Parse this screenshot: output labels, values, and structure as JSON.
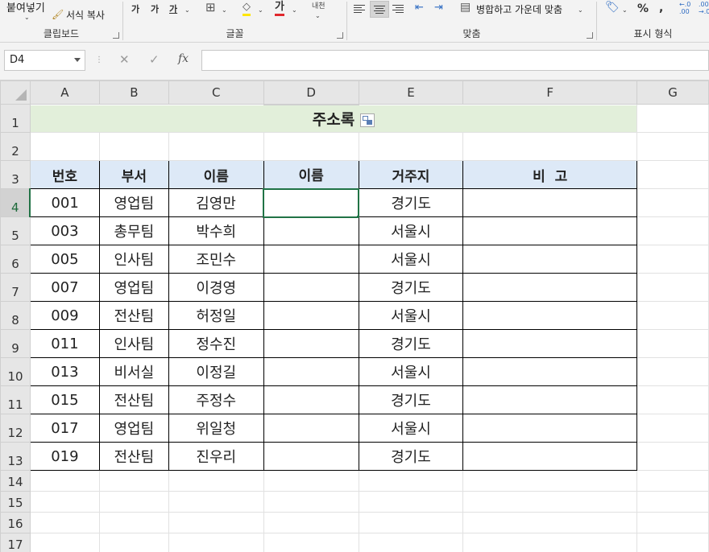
{
  "ribbon": {
    "clipboard": {
      "paste_label": "붙여넣기",
      "format_copy_label": "서식 복사",
      "group_label": "클립보드"
    },
    "font": {
      "group_label": "글꼴",
      "increase_font": "가",
      "decrease_font": "가",
      "strike_font": "가",
      "font_color_glyph": "가",
      "phonetic_glyph": "내천"
    },
    "alignment": {
      "merge_center_label": "병합하고 가운데 맞춤",
      "group_label": "맞춤"
    },
    "number": {
      "group_label": "표시 형식",
      "percent_label": "%",
      "comma_label": ","
    }
  },
  "formula_bar": {
    "name_box": "D4",
    "cancel_glyph": "✕",
    "enter_glyph": "✓",
    "fx_label": "fx",
    "formula_value": ""
  },
  "columns": [
    "A",
    "B",
    "C",
    "D",
    "E",
    "F",
    "G"
  ],
  "rows": [
    "1",
    "2",
    "3",
    "4",
    "5",
    "6",
    "7",
    "8",
    "9",
    "10",
    "11",
    "12",
    "13",
    "14",
    "15",
    "16",
    "17"
  ],
  "sheet": {
    "title": "주소록",
    "headers": [
      "번호",
      "부서",
      "이름",
      "이름",
      "거주지",
      "비  고"
    ],
    "records": [
      [
        "001",
        "영업팀",
        "김영만",
        "",
        "경기도",
        ""
      ],
      [
        "003",
        "총무팀",
        "박수희",
        "",
        "서울시",
        ""
      ],
      [
        "005",
        "인사팀",
        "조민수",
        "",
        "서울시",
        ""
      ],
      [
        "007",
        "영업팀",
        "이경영",
        "",
        "경기도",
        ""
      ],
      [
        "009",
        "전산팀",
        "허정일",
        "",
        "서울시",
        ""
      ],
      [
        "011",
        "인사팀",
        "정수진",
        "",
        "경기도",
        ""
      ],
      [
        "013",
        "비서실",
        "이정길",
        "",
        "서울시",
        ""
      ],
      [
        "015",
        "전산팀",
        "주정수",
        "",
        "경기도",
        ""
      ],
      [
        "017",
        "영업팀",
        "위일청",
        "",
        "서울시",
        ""
      ],
      [
        "019",
        "전산팀",
        "진우리",
        "",
        "경기도",
        ""
      ]
    ]
  },
  "colors": {
    "accent": "#217346",
    "title_fill": "#e2efda",
    "header_fill": "#dde9f7"
  }
}
